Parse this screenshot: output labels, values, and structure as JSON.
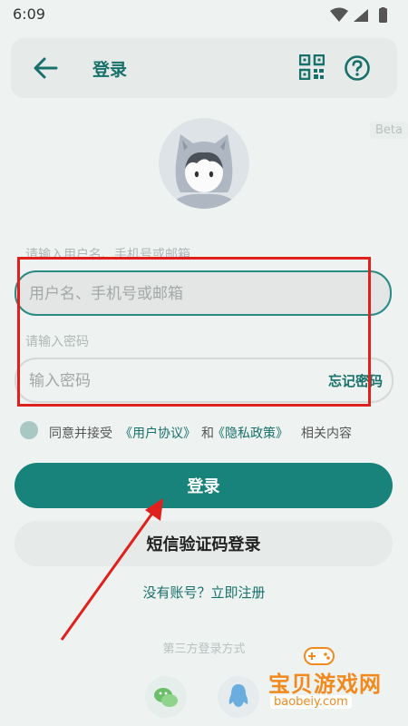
{
  "status_bar": {
    "time": "6:09"
  },
  "header": {
    "title": "登录"
  },
  "beta_badge": "Beta",
  "form": {
    "username_label": "请输入用户名、手机号或邮箱",
    "username_placeholder": "用户名、手机号或邮箱",
    "password_label": "请输入密码",
    "password_placeholder": "输入密码",
    "forgot_password": "忘记密码"
  },
  "agreement": {
    "prefix": "同意并接受",
    "user_agreement": "《用户协议》",
    "and": "和",
    "privacy_policy": "《隐私政策》",
    "suffix": "相关内容"
  },
  "buttons": {
    "login": "登录",
    "sms_login": "短信验证码登录"
  },
  "register_link": "没有账号？立即注册",
  "third_party_label": "第三方登录方式",
  "watermark": {
    "title": "宝贝游戏网",
    "url": "baobeiy.com"
  },
  "colors": {
    "accent": "#18837b",
    "annotation": "#e0201c"
  }
}
